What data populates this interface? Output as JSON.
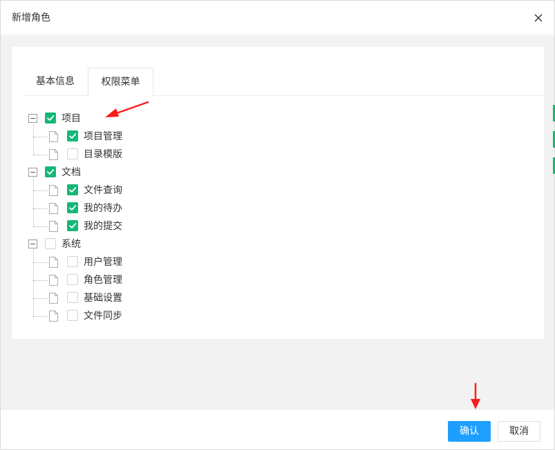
{
  "dialog": {
    "title": "新增角色",
    "close_icon": "close-icon"
  },
  "tabs": [
    {
      "label": "基本信息",
      "active": false
    },
    {
      "label": "权限菜单",
      "active": true
    }
  ],
  "tree": [
    {
      "label": "项目",
      "checked": true,
      "expanded": true,
      "children": [
        {
          "label": "项目管理",
          "checked": true
        },
        {
          "label": "目录模版",
          "checked": false
        }
      ]
    },
    {
      "label": "文档",
      "checked": true,
      "expanded": true,
      "children": [
        {
          "label": "文件查询",
          "checked": true
        },
        {
          "label": "我的待办",
          "checked": true
        },
        {
          "label": "我的提交",
          "checked": true
        }
      ]
    },
    {
      "label": "系统",
      "checked": false,
      "expanded": true,
      "children": [
        {
          "label": "用户管理",
          "checked": false
        },
        {
          "label": "角色管理",
          "checked": false
        },
        {
          "label": "基础设置",
          "checked": false
        },
        {
          "label": "文件同步",
          "checked": false
        }
      ]
    }
  ],
  "footer": {
    "confirm_label": "确认",
    "cancel_label": "取消"
  },
  "colors": {
    "checked": "#16b777",
    "primary_button": "#1e9fff",
    "annotation_arrow": "#ff1a1a",
    "body_background": "#f2f2f2"
  }
}
